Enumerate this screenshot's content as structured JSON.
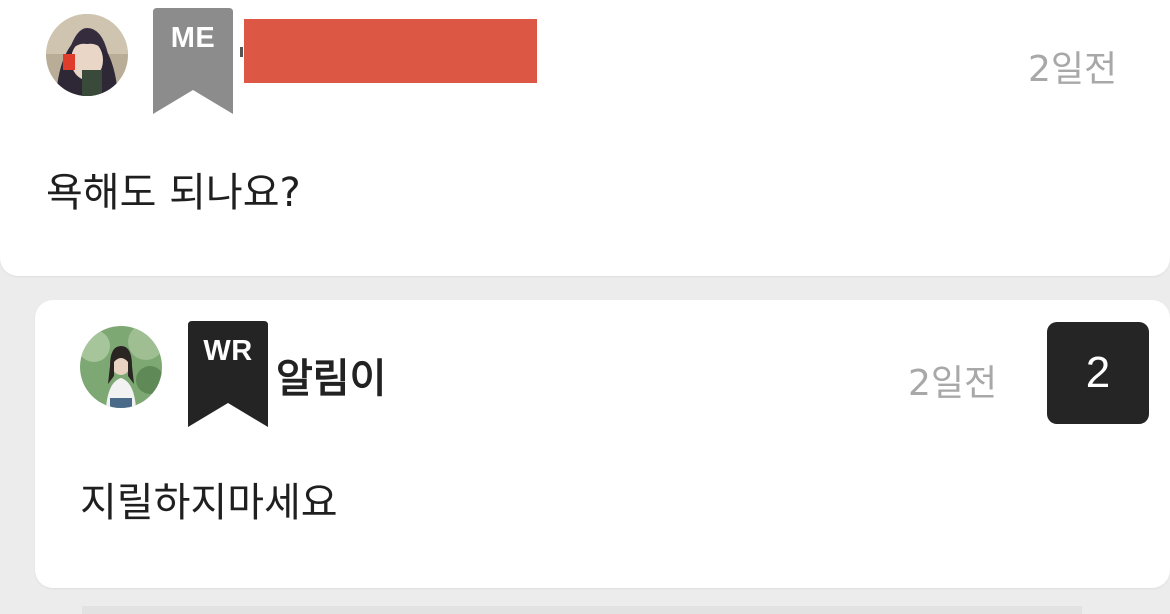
{
  "comments": [
    {
      "badge": "ME",
      "author": "",
      "time": "2일전",
      "body": "욕해도 되나요?"
    },
    {
      "badge": "WR",
      "author": "알림이",
      "time": "2일전",
      "body": "지릴하지마세요",
      "count": "2"
    }
  ],
  "colors": {
    "me_badge": "#8c8c8c",
    "wr_badge": "#242424",
    "redaction": "#dc5845",
    "time_text": "#a8a8a8",
    "count_bg": "#252525"
  }
}
